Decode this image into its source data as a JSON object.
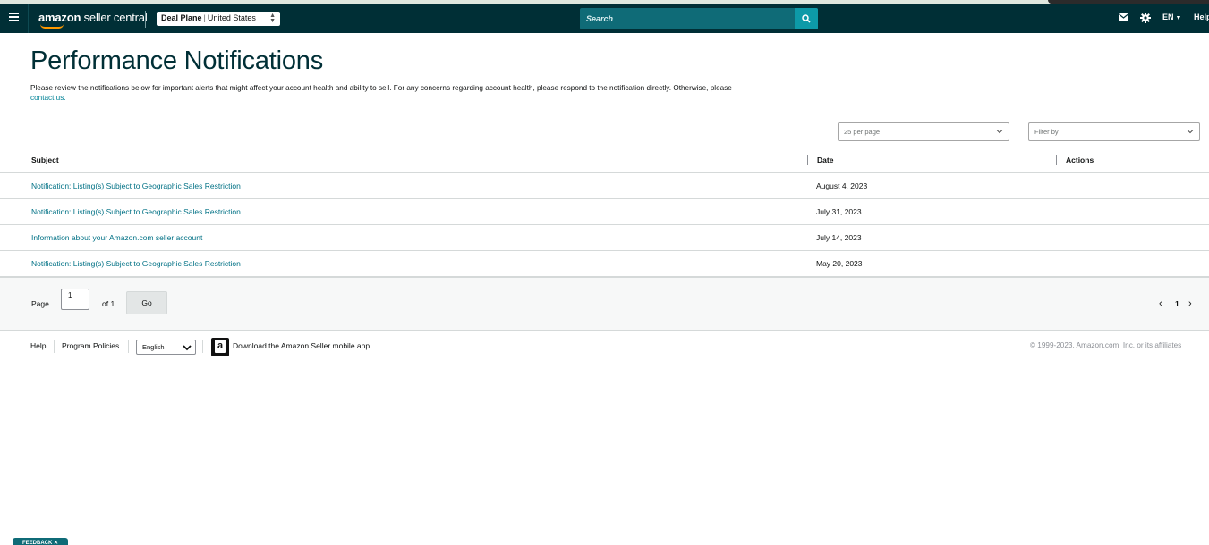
{
  "navbar": {
    "logo_brand": "amazon",
    "logo_product": "seller central",
    "account_name": "Deal Plane",
    "account_marketplace": "United States",
    "search_placeholder": "Search",
    "language": "EN",
    "help": "Help"
  },
  "page": {
    "title": "Performance Notifications",
    "intro": "Please review the notifications below for important alerts that might affect your account health and ability to sell. For any concerns regarding account health, please respond to the notification directly. Otherwise, please",
    "intro_link": "contact us."
  },
  "controls": {
    "per_page": "25 per page",
    "filter_placeholder": "Filter by"
  },
  "table": {
    "columns": [
      "Subject",
      "Date",
      "Actions"
    ],
    "rows": [
      {
        "subject": "Notification: Listing(s) Subject to Geographic Sales Restriction",
        "date": "August 4, 2023"
      },
      {
        "subject": "Notification: Listing(s) Subject to Geographic Sales Restriction",
        "date": "July 31, 2023"
      },
      {
        "subject": "Information about your Amazon.com seller account",
        "date": "July 14, 2023"
      },
      {
        "subject": "Notification: Listing(s) Subject to Geographic Sales Restriction",
        "date": "May 20, 2023"
      }
    ]
  },
  "pagination": {
    "page_label": "Page",
    "page_value": "1",
    "of_label": "of 1",
    "go_label": "Go",
    "current_page": "1"
  },
  "footer": {
    "help": "Help",
    "program_policies": "Program Policies",
    "language": "English",
    "app_download": "Download the Amazon Seller mobile app",
    "copyright": "© 1999-2023, Amazon.com, Inc. or its affiliates"
  },
  "feedback": "FEEDBACK ✕",
  "colors": {
    "navbar_bg": "#002f36",
    "search_bg": "#0f6b77",
    "search_button": "#0d9aa8",
    "link": "#007185",
    "accent_orange": "#ff9900"
  },
  "icons": [
    "menu-icon",
    "search-icon",
    "mail-icon",
    "gear-icon",
    "chevron-down-icon",
    "chevron-left-icon",
    "chevron-right-icon",
    "amazon-app-icon"
  ]
}
